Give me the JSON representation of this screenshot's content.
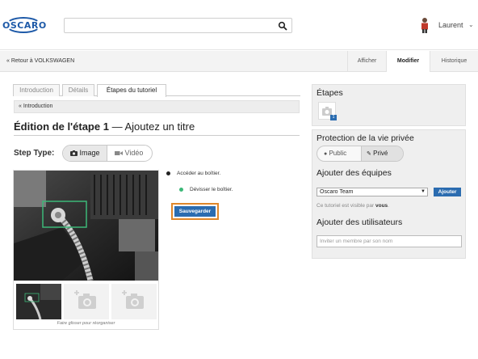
{
  "header": {
    "logo_text": "OSCARO",
    "search_placeholder": "",
    "username": "Laurent",
    "caret": "⌄"
  },
  "subbar": {
    "back_link": "« Retour à VOLKSWAGEN",
    "tabs": [
      "Afficher",
      "Modifier",
      "Historique"
    ],
    "active_tab": "Modifier"
  },
  "editor": {
    "tabs": [
      "Introduction",
      "Détails",
      "Étapes du tutoriel"
    ],
    "active_tab": "Étapes du tutoriel",
    "breadcrumb": "« Introduction",
    "title_prefix": "Édition de l'étape 1",
    "title_dash": " — ",
    "title_placeholder": "Ajoutez un titre",
    "step_type_label": "Step Type:",
    "step_type_options": [
      "Image",
      "Vidéo"
    ],
    "step_type_selected": "Image",
    "bullets": [
      {
        "text": "Accéder au boîtier.",
        "color": "#222222"
      },
      {
        "text": "Dévisser le boîtier.",
        "color": "#3cb878"
      }
    ],
    "save_button": "Sauvegarder",
    "drag_hint": "Faire glisser pour réorganiser"
  },
  "sidebar": {
    "steps_title": "Étapes",
    "step_badge": "1",
    "privacy_title": "Protection de la vie privée",
    "privacy_options": [
      "Public",
      "Privé"
    ],
    "privacy_selected": "Privé",
    "teams_title": "Ajouter des équipes",
    "team_value": "Oscaro Team",
    "team_button": "Ajouter",
    "visible_note_prefix": "Ce tutoriel est visible par ",
    "visible_note_bold": "vous",
    "visible_note_suffix": ".",
    "users_title": "Ajouter des utilisateurs",
    "users_placeholder": "Inviter un membre par son nom"
  },
  "colors": {
    "brand": "#1e5aa8",
    "accent": "#2b6cb0",
    "highlight": "#e0872a",
    "selection_box": "#3cb878"
  }
}
